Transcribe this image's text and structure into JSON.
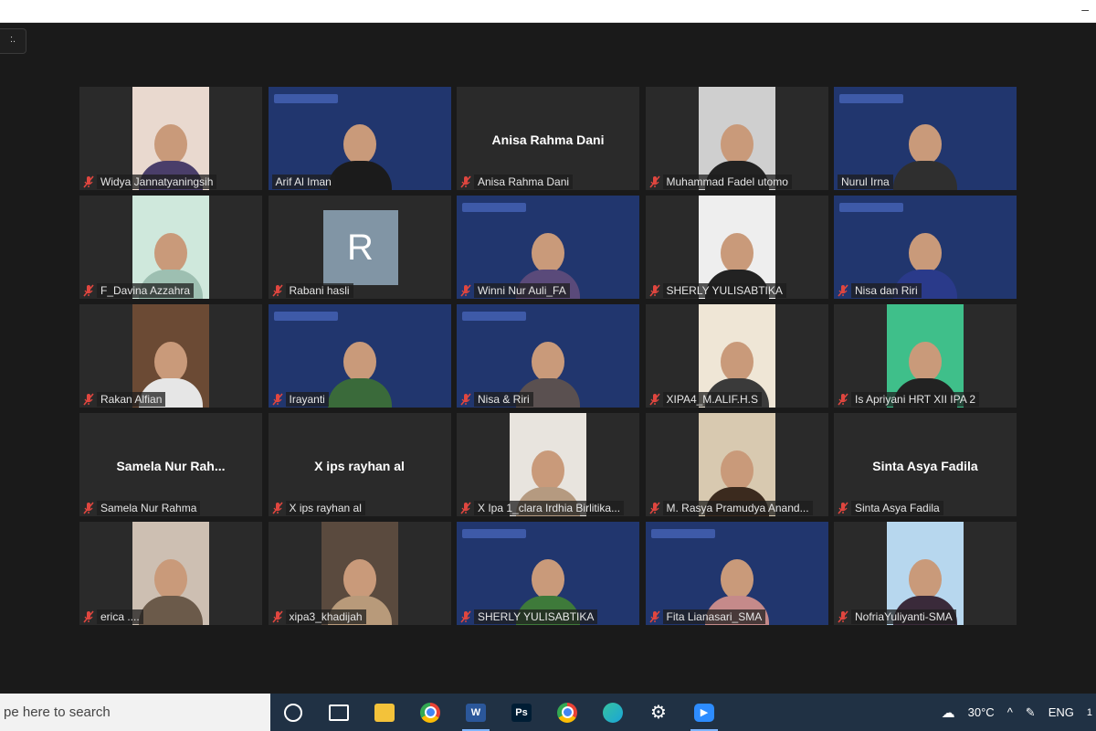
{
  "window": {
    "minimize": "–"
  },
  "view_chip": {
    "label": ":."
  },
  "accent_active": "#c9dc38",
  "participants": [
    {
      "name": "Widya Jannatyaningsih",
      "muted": true,
      "video": "face",
      "bg": "#e9d9cf",
      "fg": "#4a3e6a"
    },
    {
      "name": "Arif Al Iman",
      "muted": false,
      "video": "slide",
      "active": true,
      "fg": "#1b1b1b"
    },
    {
      "name": "Anisa Rahma Dani",
      "muted": true,
      "video": "none",
      "display": "Anisa Rahma Dani"
    },
    {
      "name": "Muhammad Fadel utomo",
      "muted": true,
      "video": "face",
      "bg": "#cfcfcf",
      "fg": "#222"
    },
    {
      "name": "Nurul Irna",
      "muted": false,
      "video": "slide",
      "fg": "#2f2f2f"
    },
    {
      "name": "F_Davina Azzahra",
      "muted": true,
      "video": "face",
      "bg": "#cfe8dc",
      "fg": "#9dbfb1"
    },
    {
      "name": "Rabani hasli",
      "muted": true,
      "video": "avatar",
      "avatar_letter": "R"
    },
    {
      "name": "Winni Nur Auli_FA",
      "muted": true,
      "video": "slide",
      "fg": "#5a4a7a"
    },
    {
      "name": "SHERLY YULISABTIKA",
      "muted": true,
      "video": "face",
      "bg": "#eeeeee",
      "fg": "#222"
    },
    {
      "name": "Nisa dan Riri",
      "muted": true,
      "video": "slide",
      "fg": "#2a3a8a"
    },
    {
      "name": "Rakan Alfian",
      "muted": true,
      "video": "face",
      "bg": "#6b4a34",
      "fg": "#e6e6e6"
    },
    {
      "name": "Irayanti",
      "muted": true,
      "video": "slide",
      "fg": "#3a6a3a"
    },
    {
      "name": "Nisa & Riri",
      "muted": true,
      "video": "slide",
      "fg": "#5a5050"
    },
    {
      "name": "XIPA4_M.ALIF.H.S",
      "muted": true,
      "video": "face",
      "bg": "#efe6d6",
      "fg": "#3a3a3a"
    },
    {
      "name": "Is Apriyani HRT XII IPA 2",
      "muted": true,
      "video": "face",
      "bg": "#3fbf8a",
      "fg": "#222"
    },
    {
      "name": "Samela Nur Rahma",
      "muted": true,
      "video": "none",
      "display": "Samela Nur Rah..."
    },
    {
      "name": "X ips rayhan al",
      "muted": true,
      "video": "none",
      "display": "X ips rayhan al"
    },
    {
      "name": "X Ipa 1_clara Irdhia Birlitika...",
      "muted": true,
      "video": "face",
      "bg": "#e8e4de",
      "fg": "#b59a80"
    },
    {
      "name": "M. Rasya Pramudya Anand...",
      "muted": true,
      "video": "face",
      "bg": "#d8c9b0",
      "fg": "#3b2a1e"
    },
    {
      "name": "Sinta Asya Fadila",
      "muted": true,
      "video": "none",
      "display": "Sinta Asya Fadila"
    },
    {
      "name": "erica ....",
      "muted": true,
      "video": "face",
      "bg": "#cdbfb2",
      "fg": "#6b5a4a"
    },
    {
      "name": "xipa3_khadijah",
      "muted": true,
      "video": "face",
      "bg": "#5a4a3e",
      "fg": "#b89a7a"
    },
    {
      "name": "SHERLY YULISABTIKA",
      "muted": true,
      "video": "slide",
      "fg": "#3e7a3a"
    },
    {
      "name": "Fita Lianasari_SMA",
      "muted": true,
      "video": "slide",
      "fg": "#c58a8a"
    },
    {
      "name": "NofriaYuliyanti-SMA",
      "muted": true,
      "video": "face",
      "bg": "#b7d7ee",
      "fg": "#3a2a3a"
    }
  ],
  "taskbar": {
    "search_placeholder": "pe here to search",
    "apps": [
      {
        "icon": "cortana-circle-icon",
        "open": false
      },
      {
        "icon": "task-view-icon",
        "open": false
      },
      {
        "icon": "file-explorer-icon",
        "open": false,
        "color": "#f3c23a"
      },
      {
        "icon": "chrome-icon",
        "open": false,
        "color": "#e94235"
      },
      {
        "icon": "word-icon",
        "open": true,
        "color": "#2b579a",
        "text": "W"
      },
      {
        "icon": "photoshop-icon",
        "open": false,
        "color": "#001d34",
        "text": "Ps"
      },
      {
        "icon": "chrome-profile-icon",
        "open": false,
        "color": "#34a853"
      },
      {
        "icon": "edge-icon",
        "open": false,
        "color": "#1aa5d8"
      },
      {
        "icon": "settings-gear-icon",
        "open": false,
        "color": "#ffffff",
        "text": "⚙"
      },
      {
        "icon": "zoom-icon",
        "open": true,
        "color": "#2d8cff"
      }
    ],
    "tray": {
      "temperature": "30°C",
      "language": "ENG",
      "clock_fragment": "1"
    }
  }
}
